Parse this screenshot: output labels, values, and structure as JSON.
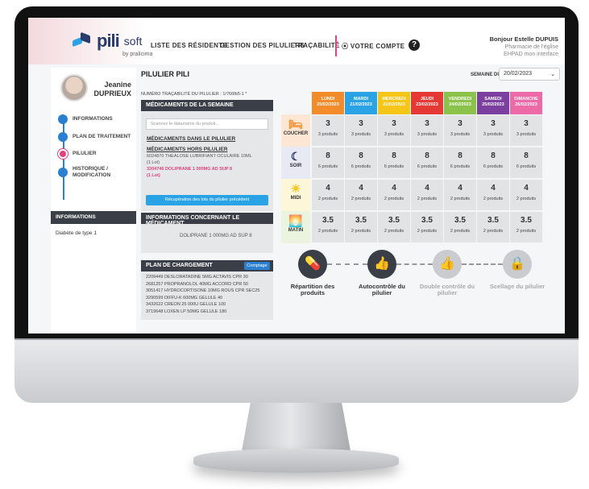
{
  "header": {
    "logo_main": "pili",
    "logo_suffix": "soft",
    "logo_by": "by pralicima",
    "nav": [
      "LISTE DES RÉSIDENTS",
      "GESTION DES PILULIERS",
      "TRAÇABILITÉ",
      "⦿ VOTRE COMPTE"
    ],
    "help": "?",
    "greeting": "Bonjour Estelle DUPUIS",
    "pharmacy": "Pharmacie de l'église",
    "ehpad": "EHPAD mon interface"
  },
  "sidebar": {
    "patient_first": "Jeanine",
    "patient_last": "DUPRIEUX",
    "items": [
      "INFORMATIONS",
      "PLAN DE TRAITEMENT",
      "PILULIER",
      "HISTORIQUE / MODIFICATION"
    ],
    "info_title": "INFORMATIONS",
    "info_text": "Diabète de type 1"
  },
  "main": {
    "title": "PILULIER PILI",
    "semaine_label": "SEMAINE DU :",
    "semaine_value": "20/02/2023",
    "trace": "NUMÉRO TRAÇABILITÉ DU PILULIER : 1/766fb5-1 *",
    "meds_title": "MÉDICAMENTS DE LA SEMAINE",
    "scan_placeholder": "Scannez le datamatrix du produit...",
    "in_pill": "MÉDICAMENTS DANS LE PILULIER",
    "out_pill": "MÉDICAMENTS HORS PILULIER",
    "out1": "6024870 THEALOSE LUBRIFIANT OCULAIRE 10ML",
    "out1_lot": "(1 Lot)",
    "out2": "3304746 DOLIPRANE 1 000MG AD SUP 8",
    "out2_lot": "(1 Lot)",
    "recup_btn": "Récupération des lots du pilulier précédent",
    "info_med_title": "INFORMATIONS CONCERNANT LE MÉDICAMENT",
    "info_med_text": "DOLIPRANE 1 000MG AD SUP 8",
    "plan_title": "PLAN DE CHARGEMENT",
    "plan_btn": "Comptage",
    "plan_items": [
      "2209449 DESLORATADINE 5MG ACTAVIS CPR 30",
      "2681257 PROPRANOLOL 40MG ACCORD CPR 50",
      "3051417 HYDROCORTISONE 10MG ROUS CPR SEC25",
      "3290599 DIFFU-K 600MG GELULE 40",
      "3432622 CREON 25 000U GELULE 100",
      "3719648 LOXEN LP 50MG GELULE 180"
    ]
  },
  "days": [
    {
      "name": "LUNDI",
      "date": "20/02/2023",
      "color": "#f28c2b"
    },
    {
      "name": "MARDI",
      "date": "21/02/2023",
      "color": "#2aa3e6"
    },
    {
      "name": "MERCREDI",
      "date": "22/02/2023",
      "color": "#f5c518"
    },
    {
      "name": "JEUDI",
      "date": "23/02/2023",
      "color": "#e53935"
    },
    {
      "name": "VENDREDI",
      "date": "24/02/2023",
      "color": "#8bc34a"
    },
    {
      "name": "SAMEDI",
      "date": "25/02/2023",
      "color": "#7b3fa0"
    },
    {
      "name": "DIMANCHE",
      "date": "26/02/2023",
      "color": "#ec6aa8"
    }
  ],
  "rows": [
    {
      "label": "COUCHER",
      "icon": "bed-icon",
      "value": "3",
      "count": "3 produits",
      "color": "#f28c2b"
    },
    {
      "label": "SOIR",
      "icon": "moon-icon",
      "value": "8",
      "count": "6 produits",
      "color": "#2a3b6e"
    },
    {
      "label": "MIDI",
      "icon": "sun-icon",
      "value": "4",
      "count": "2 produits",
      "color": "#f5c518"
    },
    {
      "label": "MATIN",
      "icon": "sunrise-icon",
      "value": "3.5",
      "count": "2 produits",
      "color": "#8bc34a"
    }
  ],
  "steps": [
    {
      "label": "Répartition des produits",
      "icon": "pill-icon",
      "color": "#3a3f47"
    },
    {
      "label": "Autocontrôle du pilulier",
      "icon": "thumb-icon",
      "color": "#3a3f47"
    },
    {
      "label": "Double contrôle du pilulier",
      "icon": "thumb-icon",
      "color": "#c9cbce"
    },
    {
      "label": "Scellage du pilulier",
      "icon": "lock-icon",
      "color": "#c9cbce"
    }
  ]
}
